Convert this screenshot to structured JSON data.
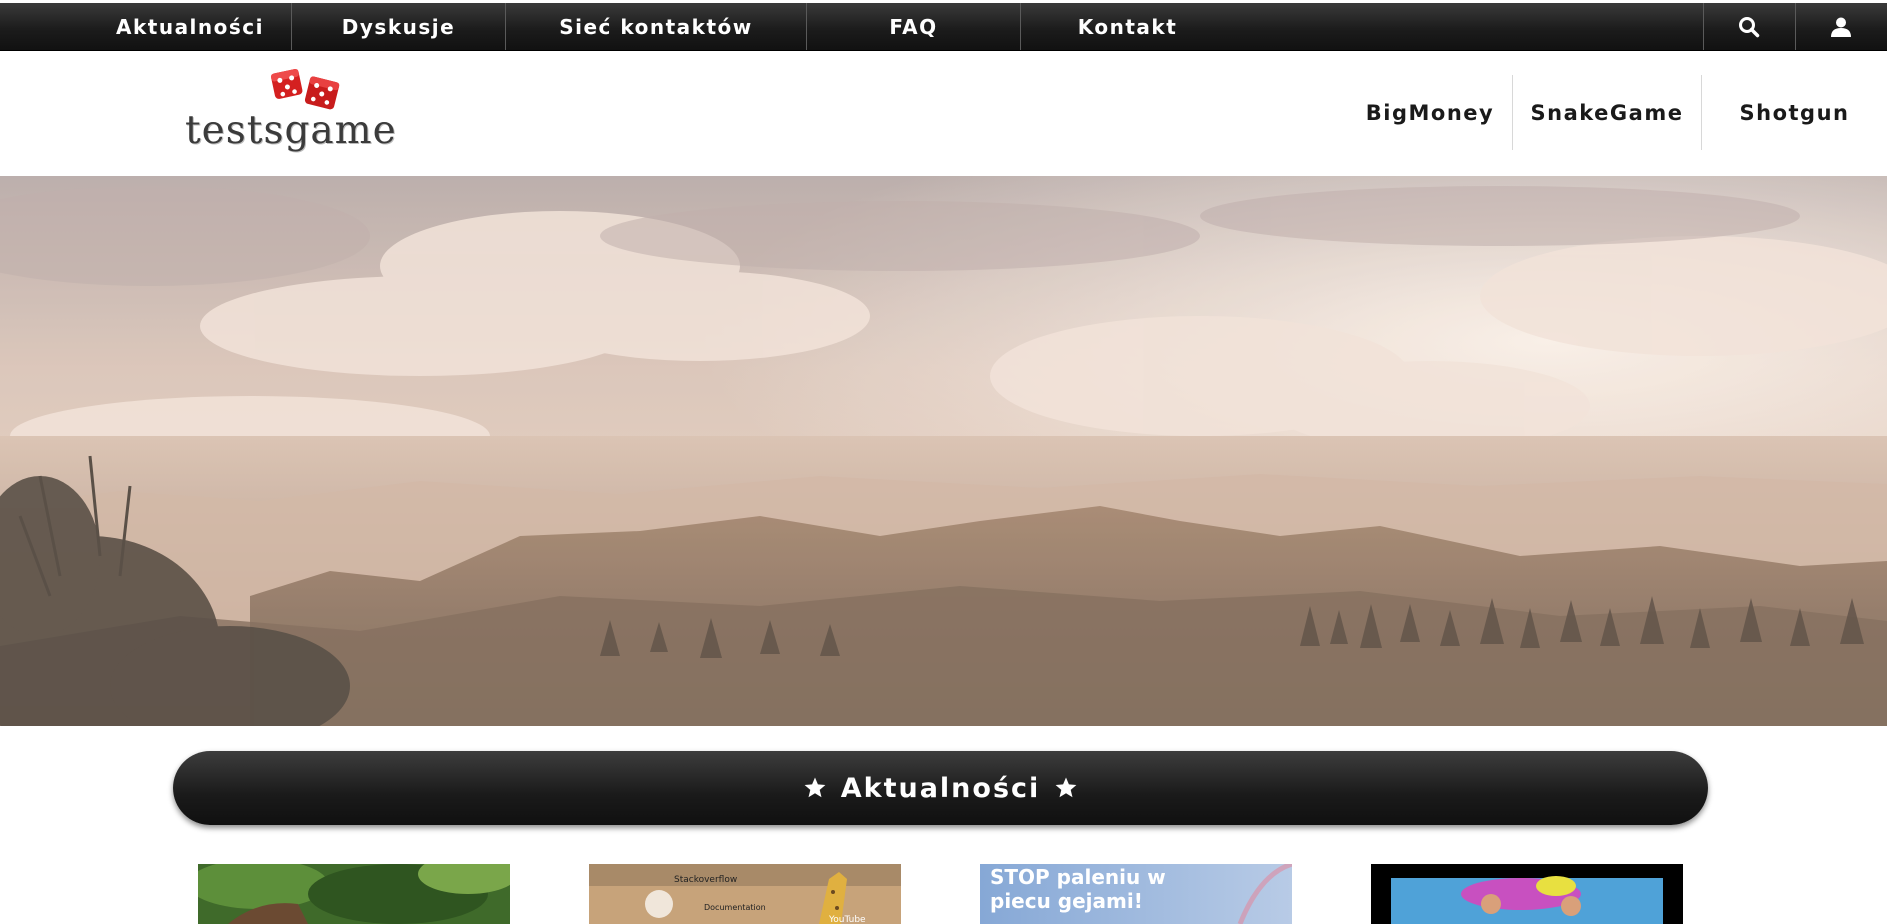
{
  "top_nav": {
    "items": [
      "Aktualności",
      "Dyskusje",
      "Sieć kontaktów",
      "FAQ",
      "Kontakt"
    ],
    "search_icon": "search-icon",
    "user_icon": "user-icon"
  },
  "header": {
    "logo_text": "testsgame",
    "logo_icon": "dice-icon",
    "nav": [
      "BigMoney",
      "SnakeGame",
      "Shotgun"
    ]
  },
  "hero": {
    "image": "mountain-landscape-with-clouds"
  },
  "section": {
    "title": "Aktualności",
    "icon": "star-icon"
  },
  "news": {
    "thumbnails": [
      {
        "image": "forest-photo"
      },
      {
        "image": "cartoon-noahs-ark",
        "texts": [
          "Stackoverflow",
          "Documentation",
          "YouTube"
        ]
      },
      {
        "image": "stop-banner",
        "texts": [
          "STOP paleniu w",
          "piecu gejami!"
        ]
      },
      {
        "image": "pool-party-photo"
      }
    ]
  },
  "colors": {
    "nav_bg": "#1e1e1e",
    "dice_red": "#d42020",
    "text_dark": "#1a1a1a"
  }
}
